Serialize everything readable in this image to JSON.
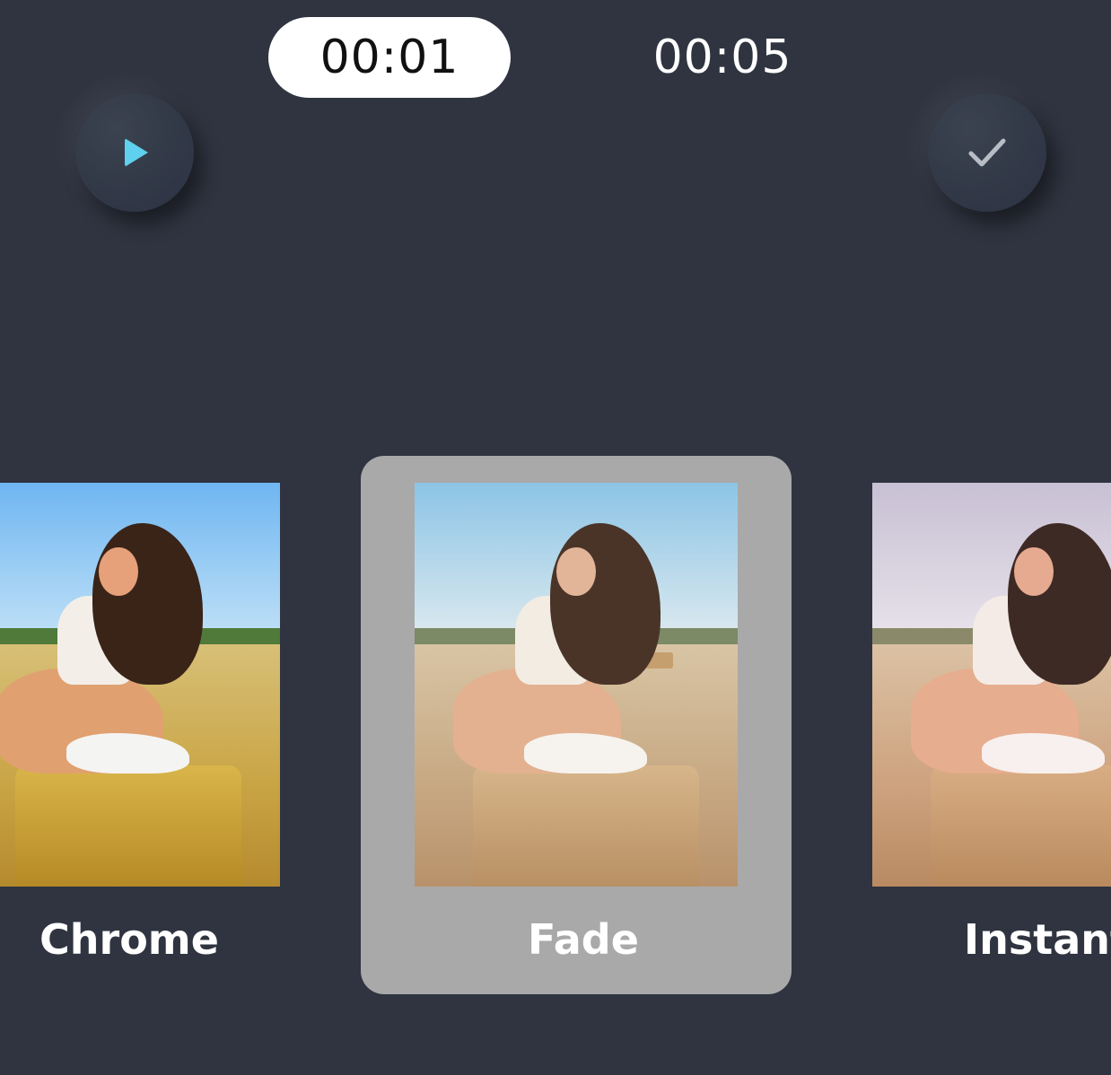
{
  "timeline": {
    "current_time": "00:01",
    "end_time": "00:05"
  },
  "controls": {
    "play_icon": "play-icon",
    "confirm_icon": "checkmark-icon",
    "play_color": "#5fd0ee",
    "check_color": "#b8bcc4"
  },
  "filters": [
    {
      "label": "Chrome",
      "selected": false
    },
    {
      "label": "Fade",
      "selected": true
    },
    {
      "label": "Instant",
      "selected": false
    }
  ],
  "colors": {
    "background": "#2f3440",
    "selected_card": "#a9a9a9",
    "pill": "#ffffff"
  }
}
